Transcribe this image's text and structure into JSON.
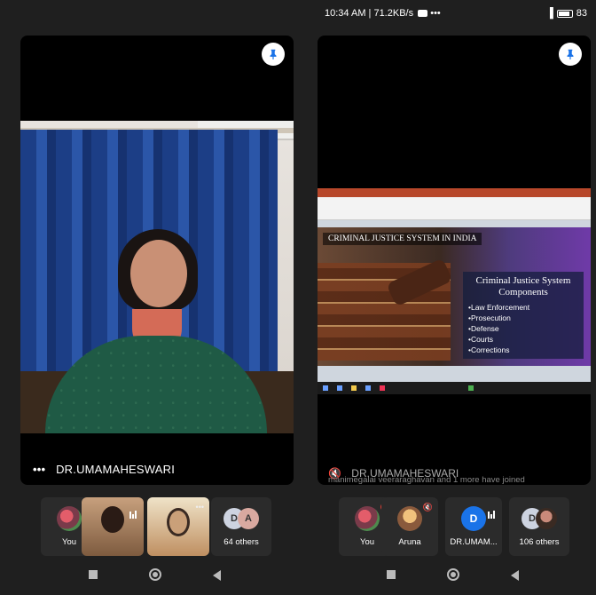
{
  "left": {
    "speaker_name": "DR.UMAMAHESWARI",
    "more_dots": "•••",
    "tiles": [
      {
        "label": "You",
        "icon": "mic-off-icon"
      },
      {
        "label": "",
        "icon": "audio-level-icon"
      },
      {
        "label": "",
        "icon": "more-icon"
      },
      {
        "label": "64 others",
        "avatars": [
          "D",
          "A"
        ]
      }
    ]
  },
  "right": {
    "status": {
      "time": "10:34 AM | 71.2KB/s",
      "extra": "•••",
      "battery": "83"
    },
    "speaker_name": "DR.UMAMAHESWARI",
    "join_notice": "manimegalai veeraraghavan and 1 more have joined",
    "slide": {
      "title": "CRIMINAL JUSTICE SYSTEM IN INDIA",
      "box_title": "Criminal Justice System Components",
      "items": [
        "Law Enforcement",
        "Prosecution",
        "Defense",
        "Courts",
        "Corrections"
      ]
    },
    "tiles": [
      {
        "label": "You",
        "icon": "mic-off-icon"
      },
      {
        "label": "Aruna",
        "icon": "mic-off-icon"
      },
      {
        "label": "DR.UMAM...",
        "avatar": "D"
      },
      {
        "label": "106 others",
        "avatars": [
          "D"
        ]
      }
    ]
  },
  "colors": {
    "background": "#1f1f1f",
    "stage": "#000000",
    "accent": "#1a73e8"
  }
}
